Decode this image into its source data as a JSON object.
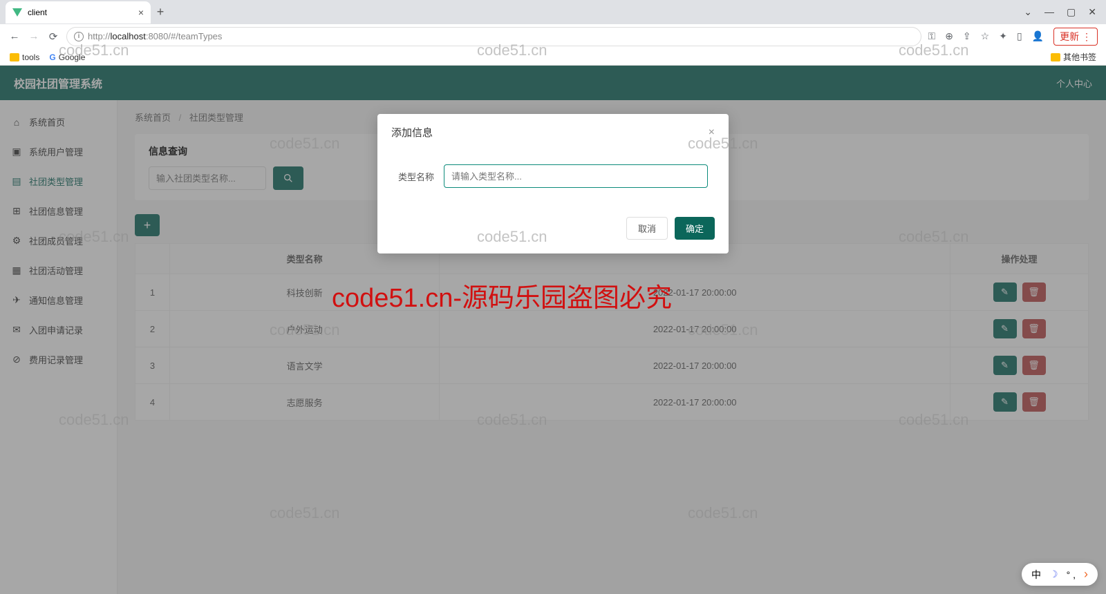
{
  "browser": {
    "tab_title": "client",
    "url_scheme": "http://",
    "url_host": "localhost",
    "url_rest": ":8080/#/teamTypes",
    "update_label": "更新",
    "bookmarks": {
      "tools": "tools",
      "google": "Google",
      "other": "其他书签"
    },
    "window": {
      "min": "—",
      "max": "▢",
      "close": "✕",
      "down": "⌄"
    }
  },
  "app": {
    "title": "校园社团管理系统",
    "header_right": "个人中心",
    "breadcrumb": {
      "home": "系统首页",
      "current": "社团类型管理"
    },
    "sidebar": [
      {
        "icon": "⌂",
        "label": "系统首页"
      },
      {
        "icon": "▣",
        "label": "系统用户管理"
      },
      {
        "icon": "▤",
        "label": "社团类型管理"
      },
      {
        "icon": "⊞",
        "label": "社团信息管理"
      },
      {
        "icon": "⚙",
        "label": "社团成员管理"
      },
      {
        "icon": "▦",
        "label": "社团活动管理"
      },
      {
        "icon": "✈",
        "label": "通知信息管理"
      },
      {
        "icon": "✉",
        "label": "入团申请记录"
      },
      {
        "icon": "⊘",
        "label": "费用记录管理"
      }
    ],
    "search_panel_title": "信息查询",
    "search_placeholder": "输入社团类型名称...",
    "table_headers": {
      "col_name": "类型名称",
      "col_action": "操作处理"
    },
    "rows": [
      {
        "idx": "1",
        "name": "科技创新",
        "time": "2022-01-17 20:00:00"
      },
      {
        "idx": "2",
        "name": "户外运动",
        "time": "2022-01-17 20:00:00"
      },
      {
        "idx": "3",
        "name": "语言文学",
        "time": "2022-01-17 20:00:00"
      },
      {
        "idx": "4",
        "name": "志愿服务",
        "time": "2022-01-17 20:00:00"
      }
    ]
  },
  "modal": {
    "title": "添加信息",
    "field_label": "类型名称",
    "placeholder": "请输入类型名称...",
    "cancel": "取消",
    "ok": "确定"
  },
  "watermark": {
    "text": "code51.cn",
    "red": "code51.cn-源码乐园盗图必究"
  },
  "ime": {
    "zh": "中",
    "dots": "° ,",
    "arrow": "›"
  }
}
